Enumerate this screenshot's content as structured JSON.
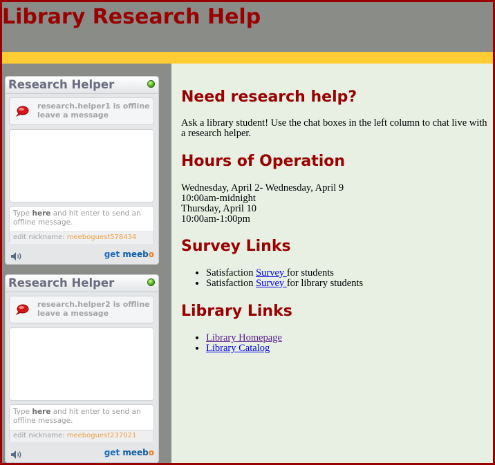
{
  "site": {
    "title": "Library Research Help"
  },
  "widgets": [
    {
      "title": "Research Helper",
      "status_line1": "research.helper1 is offline",
      "status_line2": "leave a message",
      "input_pre": "Type ",
      "input_bold": "here",
      "input_post": " and hit enter to send an offline message.",
      "nick_label": "edit nickname: ",
      "nick_value": "meeboguest578434",
      "brand_get": "get",
      "brand_meebo": "meeb",
      "brand_o": "o"
    },
    {
      "title": "Research Helper",
      "status_line1": "research.helper2 is offline",
      "status_line2": "leave a message",
      "input_pre": "Type ",
      "input_bold": "here",
      "input_post": " and hit enter to send an offline message.",
      "nick_label": "edit nickname: ",
      "nick_value": "meeboguest237021",
      "brand_get": "get",
      "brand_meebo": "meeb",
      "brand_o": "o"
    }
  ],
  "main": {
    "help_heading": "Need research help?",
    "help_text": "Ask a library student! Use the chat boxes in the left column to chat live with a research helper.",
    "hours_heading": "Hours of Operation",
    "hours": [
      "Wednesday, April 2- Wednesday, April 9",
      "10:00am-midnight",
      "Thursday, April 10",
      "10:00am-1:00pm"
    ],
    "survey_heading": "Survey Links",
    "survey_items": [
      {
        "pre": "Satisfaction ",
        "link": "Survey ",
        "post": "for students"
      },
      {
        "pre": "Satisfaction ",
        "link": "Survey ",
        "post": "for library students"
      }
    ],
    "library_heading": "Library Links",
    "library_links": [
      "Library Homepage",
      "Library Catalog"
    ]
  },
  "colors": {
    "heading": "#990000",
    "accent_bar": "#ffcc33",
    "content_bg": "#e8f0e4",
    "sidebar_bg": "#8a8c88",
    "border": "#990000"
  }
}
